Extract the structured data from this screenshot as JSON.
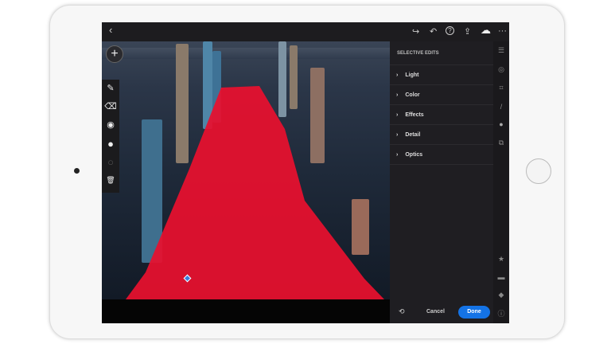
{
  "topbar": {
    "back_icon": "‹",
    "redo_icon": "↪",
    "undo_icon": "↶",
    "help_icon": "?",
    "share_icon": "⇪",
    "cloud_icon": "☁",
    "more_icon": "···"
  },
  "tools": {
    "add_icon": "+",
    "brush_icon": "✎",
    "eraser_icon": "⌫",
    "radial_icon": "◉",
    "filled_circle_icon": "●",
    "empty_circle_icon": "○",
    "trash_icon": "🗑"
  },
  "panel": {
    "title": "SELECTIVE EDITS",
    "sections": [
      {
        "label": "Light"
      },
      {
        "label": "Color"
      },
      {
        "label": "Effects"
      },
      {
        "label": "Detail"
      },
      {
        "label": "Optics"
      }
    ]
  },
  "footer": {
    "reset_icon": "⟲",
    "cancel_label": "Cancel",
    "done_label": "Done"
  },
  "colors": {
    "mask_red": "#e8102e",
    "accent": "#1473e6",
    "panel_bg": "#1f1e22"
  }
}
